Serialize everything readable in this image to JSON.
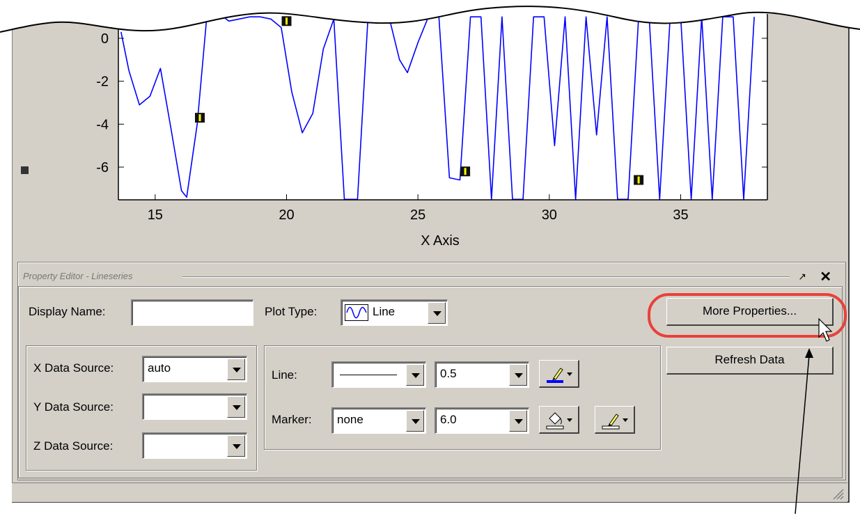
{
  "chart_data": {
    "type": "line",
    "xlabel": "X Axis",
    "ylabel": "",
    "xlim": [
      13.6,
      38.3
    ],
    "ylim": [
      -7.5,
      0.9
    ],
    "x_ticks": [
      "15",
      "20",
      "25",
      "30",
      "35"
    ],
    "y_ticks": [
      "0",
      "-2",
      "-4",
      "-6"
    ],
    "grid": false,
    "series": [
      {
        "color": "#0000ff",
        "x": [
          13.7,
          14.0,
          14.4,
          14.8,
          15.2,
          15.6,
          16.0,
          16.2,
          16.6,
          17.0,
          17.3,
          17.6,
          17.8,
          18.2,
          18.6,
          19.0,
          19.4,
          19.8,
          20.2,
          20.6,
          21.0,
          21.4,
          21.8,
          22.2,
          22.7,
          23.1,
          23.5,
          23.9,
          24.3,
          24.6,
          25.0,
          25.4,
          25.8,
          26.2,
          26.6,
          27.0,
          27.4,
          27.8,
          28.2,
          28.6,
          29.0,
          29.4,
          29.8,
          30.2,
          30.6,
          31.0,
          31.4,
          31.8,
          32.2,
          32.6,
          33.0,
          33.4,
          33.8,
          34.2,
          34.6,
          35.0,
          35.4,
          35.8,
          36.2,
          36.6,
          37.0,
          37.4,
          37.8
        ],
        "y": [
          0.3,
          -1.5,
          -3.1,
          -2.7,
          -1.4,
          -4.2,
          -7.1,
          -7.4,
          -4.0,
          1.5,
          1.5,
          1.0,
          0.8,
          0.9,
          1.0,
          1.0,
          0.9,
          0.5,
          -2.5,
          -4.4,
          -3.5,
          -0.5,
          0.9,
          -7.5,
          -7.5,
          1.0,
          1.0,
          1.0,
          -1.0,
          -1.6,
          -0.2,
          1.0,
          1.0,
          -6.5,
          -6.6,
          1.0,
          1.0,
          -7.5,
          1.0,
          -7.5,
          -7.5,
          1.0,
          1.0,
          -5.0,
          1.0,
          -7.5,
          1.0,
          -4.5,
          1.0,
          -7.5,
          -7.5,
          1.0,
          1.0,
          -7.5,
          1.0,
          1.0,
          -7.5,
          1.0,
          -7.5,
          1.0,
          1.0,
          -7.5,
          1.0
        ]
      }
    ],
    "markers": [
      {
        "x": 16.7,
        "y": -3.7
      },
      {
        "x": 20.0,
        "y": 0.8
      },
      {
        "x": 26.8,
        "y": -6.2
      },
      {
        "x": 33.4,
        "y": -6.6
      }
    ]
  },
  "property_editor": {
    "title": "Property Editor - Lineseries",
    "display_name_label": "Display Name:",
    "display_name_value": "",
    "plot_type_label": "Plot Type:",
    "plot_type_value": "Line",
    "x_source_label": "X Data Source:",
    "x_source_value": "auto",
    "y_source_label": "Y Data Source:",
    "y_source_value": "",
    "z_source_label": "Z Data Source:",
    "z_source_value": "",
    "line_label": "Line:",
    "line_width": "0.5",
    "marker_label": "Marker:",
    "marker_value": "none",
    "marker_size": "6.0",
    "more_properties_label": "More Properties...",
    "refresh_data_label": "Refresh Data",
    "pin_glyph": "↗",
    "close_glyph": "✕"
  },
  "colors": {
    "series": "#0000ff",
    "highlight": "#e8413a",
    "panel": "#d4d0c8"
  },
  "icons": [
    "line-color-icon",
    "marker-fill-icon",
    "marker-edge-icon",
    "plot-type-line-icon",
    "mouse-cursor-icon",
    "resize-grip-icon",
    "legend-square-icon"
  ]
}
